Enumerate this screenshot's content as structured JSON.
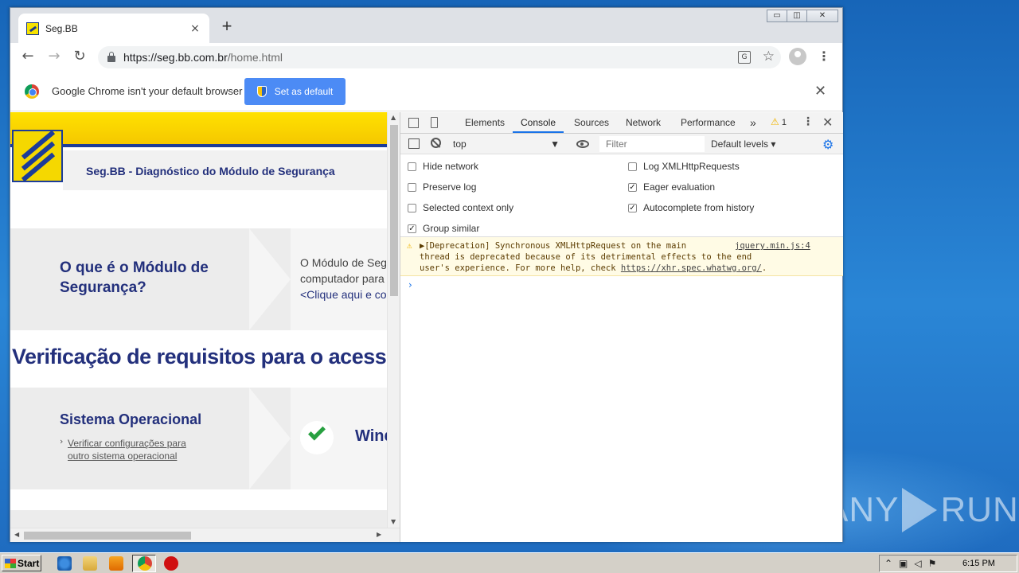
{
  "browser": {
    "tab_title": "Seg.BB",
    "tab_close": "×",
    "new_tab": "+",
    "url_host": "https://seg.bb.com.br",
    "url_path": "/home.html",
    "window_buttons": [
      "▭",
      "◫",
      "✕"
    ],
    "nav": {
      "back": "←",
      "forward": "→",
      "reload": "↻"
    },
    "star": "☆",
    "menu": "⋮"
  },
  "infobar": {
    "message": "Google Chrome isn't your default browser",
    "button_label": "Set as default",
    "close": "✕"
  },
  "page": {
    "header_title": "Seg.BB - Diagnóstico do Módulo de Segurança",
    "question_title": "O que é o Módulo de Segurança?",
    "question_desc_line1": "O Módulo de Seg",
    "question_desc_line2": "computador para",
    "question_link": "<Clique aqui e co",
    "verification_title": "Verificação de requisitos para o acess",
    "os_title": "Sistema Operacional",
    "os_link": "Verificar configurações para outro sistema operacional",
    "os_value": "Wind",
    "colors": {
      "brand_yellow": "#f5d800",
      "brand_blue": "#23307c",
      "check_green": "#27a040"
    }
  },
  "devtools": {
    "tabs": [
      "Elements",
      "Console",
      "Sources",
      "Network",
      "Performance"
    ],
    "more_tabs": "»",
    "active_tab": "Console",
    "warning_count": "1",
    "context": "top",
    "filter_placeholder": "Filter",
    "levels": "Default levels ▾",
    "settings_left": [
      {
        "label": "Hide network",
        "checked": false
      },
      {
        "label": "Preserve log",
        "checked": false
      },
      {
        "label": "Selected context only",
        "checked": false
      },
      {
        "label": "Group similar",
        "checked": true
      }
    ],
    "settings_right": [
      {
        "label": "Log XMLHttpRequests",
        "checked": false
      },
      {
        "label": "Eager evaluation",
        "checked": true
      },
      {
        "label": "Autocomplete from history",
        "checked": true
      }
    ],
    "message_line1": "▶[Deprecation] Synchronous XMLHttpRequest on the main",
    "message_line2": "thread is deprecated because of its detrimental effects to the end",
    "message_line3_prefix": "user's experience. For more help, check ",
    "message_link": "https://xhr.spec.whatwg.org/",
    "message_line3_suffix": ".",
    "message_source": "jquery.min.js:4",
    "prompt": "›"
  },
  "taskbar": {
    "start_label": "Start",
    "clock": "6:15 PM"
  },
  "watermark": {
    "left": "ANY",
    "right": "RUN"
  }
}
